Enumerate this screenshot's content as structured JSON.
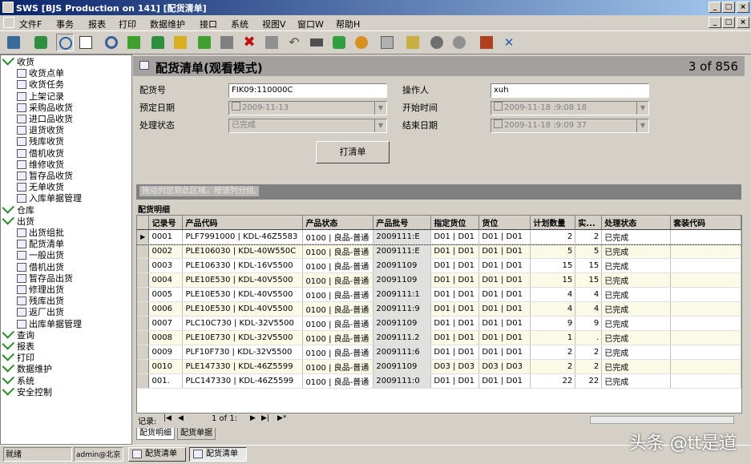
{
  "window": {
    "title": "SWS [BJS Production on 141]  [配货清单]",
    "minimize": "_",
    "restore": "□",
    "close": "×"
  },
  "menu": [
    "文件F",
    "事务",
    "报表",
    "打印",
    "数据维护",
    "接口",
    "系统",
    "视图V",
    "窗口W",
    "帮助H"
  ],
  "toolbar_icons": [
    "tool-icon",
    "refresh-icon",
    "window-icon",
    "edit-icon",
    "search-icon",
    "save-green-icon",
    "import-icon",
    "export-icon",
    "transfer-icon",
    "stop-icon",
    "delete-icon",
    "blank-icon",
    "undo-icon",
    "list-icon",
    "stack-icon",
    "globe-icon",
    "print-icon",
    "check-doc-icon",
    "gear-icon",
    "settings-icon",
    "exit-icon",
    "tools-icon"
  ],
  "tree": [
    {
      "label": "收货",
      "level": 0
    },
    {
      "label": "收货点单",
      "level": 1
    },
    {
      "label": "收货任务",
      "level": 1
    },
    {
      "label": "上架记录",
      "level": 1
    },
    {
      "label": "采购品收货",
      "level": 1
    },
    {
      "label": "进口品收货",
      "level": 1
    },
    {
      "label": "退货收货",
      "level": 1
    },
    {
      "label": "残库收货",
      "level": 1
    },
    {
      "label": "借机收货",
      "level": 1
    },
    {
      "label": "维修收货",
      "level": 1
    },
    {
      "label": "暂存品收货",
      "level": 1
    },
    {
      "label": "无单收货",
      "level": 1
    },
    {
      "label": "入库单据管理",
      "level": 1
    },
    {
      "label": "仓库",
      "level": 0
    },
    {
      "label": "出货",
      "level": 0
    },
    {
      "label": "出货组批",
      "level": 1
    },
    {
      "label": "配货清单",
      "level": 1
    },
    {
      "label": "一般出货",
      "level": 1
    },
    {
      "label": "借机出货",
      "level": 1
    },
    {
      "label": "暂存品出货",
      "level": 1
    },
    {
      "label": "修理出货",
      "level": 1
    },
    {
      "label": "残库出货",
      "level": 1
    },
    {
      "label": "返厂出货",
      "level": 1
    },
    {
      "label": "出库单据管理",
      "level": 1
    },
    {
      "label": "查询",
      "level": 0
    },
    {
      "label": "报表",
      "level": 0
    },
    {
      "label": "打印",
      "level": 0
    },
    {
      "label": "数据维护",
      "level": 0
    },
    {
      "label": "系统",
      "level": 0
    },
    {
      "label": "安全控制",
      "level": 0
    }
  ],
  "header": {
    "title": "配货清单(观看模式)",
    "counter": "3 of 856"
  },
  "form": {
    "order_no_label": "配货号",
    "order_no": "FIK09:110000C",
    "operator_label": "操作人",
    "operator": "xuh",
    "plan_date_label": "预定日期",
    "plan_date": "2009-11-13",
    "start_time_label": "开始时间",
    "start_time": "2009-11-18 :9:08 18",
    "status_label": "处理状态",
    "status": "已完成",
    "end_time_label": "结束日期",
    "end_time": "2009-11-18 :9:09 37",
    "print_button": "打清单"
  },
  "grid": {
    "group_hint": "拖动列您到此区域，按该列分组.",
    "section_label": "配货明细",
    "columns": [
      "记录号",
      "产品代码",
      "产品状态",
      "产品批号",
      "指定货位",
      "货位",
      "计划数量",
      "实...",
      "处理状态",
      "套装代码"
    ],
    "rows": [
      [
        "0001",
        "PLF7991000 | KDL-46Z5583",
        "0100 | 良品-普通",
        "2009111:E",
        "D01 | D01",
        "D01 | D01",
        "2",
        "2",
        "已完成",
        ""
      ],
      [
        "0002",
        "PLE106030 | KDL-40W550C",
        "0100 | 良品-普通",
        "2009111:E",
        "D01 | D01",
        "D01 | D01",
        "5",
        "5",
        "已完成",
        ""
      ],
      [
        "0003",
        "PLE106330 | KDL-16V5500",
        "0100 | 良品-普通",
        "20091109",
        "D01 | D01",
        "D01 | D01",
        "15",
        "15",
        "已完成",
        ""
      ],
      [
        "0004",
        "PLE10E530 | KDL-40V5500",
        "0100 | 良品-普通",
        "20091109",
        "D01 | D01",
        "D01 | D01",
        "15",
        "15",
        "已完成",
        ""
      ],
      [
        "0005",
        "PLE10E530 | KDL-40V5500",
        "0100 | 良品-普通",
        "2009111:1",
        "D01 | D01",
        "D01 | D01",
        "4",
        "4",
        "已完成",
        ""
      ],
      [
        "0006",
        "PLE10E530 | KDL-40V5500",
        "0100 | 良品-普通",
        "2009111:9",
        "D01 | D01",
        "D01 | D01",
        "4",
        "4",
        "已完成",
        ""
      ],
      [
        "0007",
        "PLC10C730 | KDL-32V5500",
        "0100 | 良品-普通",
        "20091109",
        "D01 | D01",
        "D01 | D01",
        "9",
        "9",
        "已完成",
        ""
      ],
      [
        "0008",
        "PLE10E730 | KDL-32V5500",
        "0100 | 良品-普通",
        "2009111.2",
        "D01 | D01",
        "D01 | D01",
        "1",
        ".",
        "已完成",
        ""
      ],
      [
        "0009",
        "PLF10F730 | KDL-32V5500",
        "0100 | 良品-普通",
        "2009111:6",
        "D01 | D01",
        "D01 | D01",
        "2",
        "2",
        "已完成",
        ""
      ],
      [
        "0010",
        "PLE147330 | KDL-46Z5599",
        "0100 | 良品-普通",
        "20091109",
        "D03 | D03",
        "D03 | D03",
        "2",
        "2",
        "已完成",
        ""
      ],
      [
        "001.",
        "PLC147330 | KDL-46Z5599",
        "0100 | 良品-普通",
        "2009111:0",
        "D01 | D01",
        "D01 | D01",
        "22",
        "22",
        "已完成",
        ""
      ]
    ]
  },
  "navigator": {
    "label": "记录:",
    "first": "|◀",
    "prev": "◀",
    "page": "1 of 1:",
    "next": "▶",
    "last": "▶|",
    "new": "▶*"
  },
  "tabs": [
    "配货明细",
    "配货单据"
  ],
  "status": {
    "ready": "就绪",
    "user": "admin@北京",
    "window1": "配货清单",
    "window2": "配货清单"
  },
  "watermark": "头条 @tt是道"
}
